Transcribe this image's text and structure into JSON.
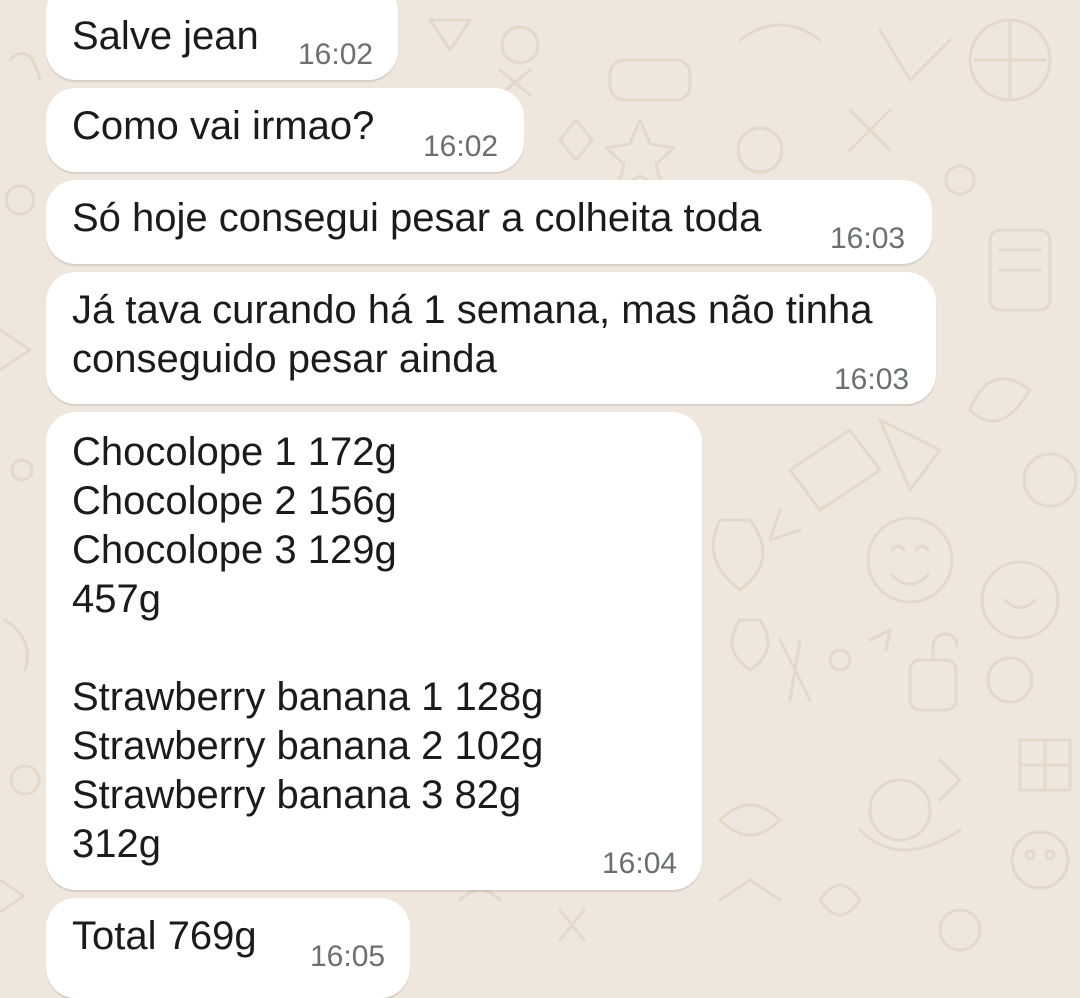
{
  "chat": {
    "messages": [
      {
        "text": "Salve jean",
        "time": "16:02"
      },
      {
        "text": "Como vai irmao?",
        "time": "16:02"
      },
      {
        "text": "Só hoje consegui pesar a colheita toda",
        "time": "16:03"
      },
      {
        "text": "Já tava curando há 1 semana, mas não tinha\nconseguido pesar ainda",
        "time": "16:03"
      },
      {
        "text": "Chocolope 1 172g\nChocolope 2 156g\nChocolope 3 129g\n457g\n\nStrawberry banana 1 128g\nStrawberry banana 2 102g\nStrawberry banana 3 82g\n312g",
        "time": "16:04"
      },
      {
        "text": "Total 769g",
        "time": "16:05"
      }
    ]
  },
  "colors": {
    "wallpaper": "#efe7dd",
    "doodle_stroke": "#e3d8ca",
    "bubble": "#ffffff",
    "text": "#1b1b1b",
    "timestamp": "#6b6f72"
  }
}
